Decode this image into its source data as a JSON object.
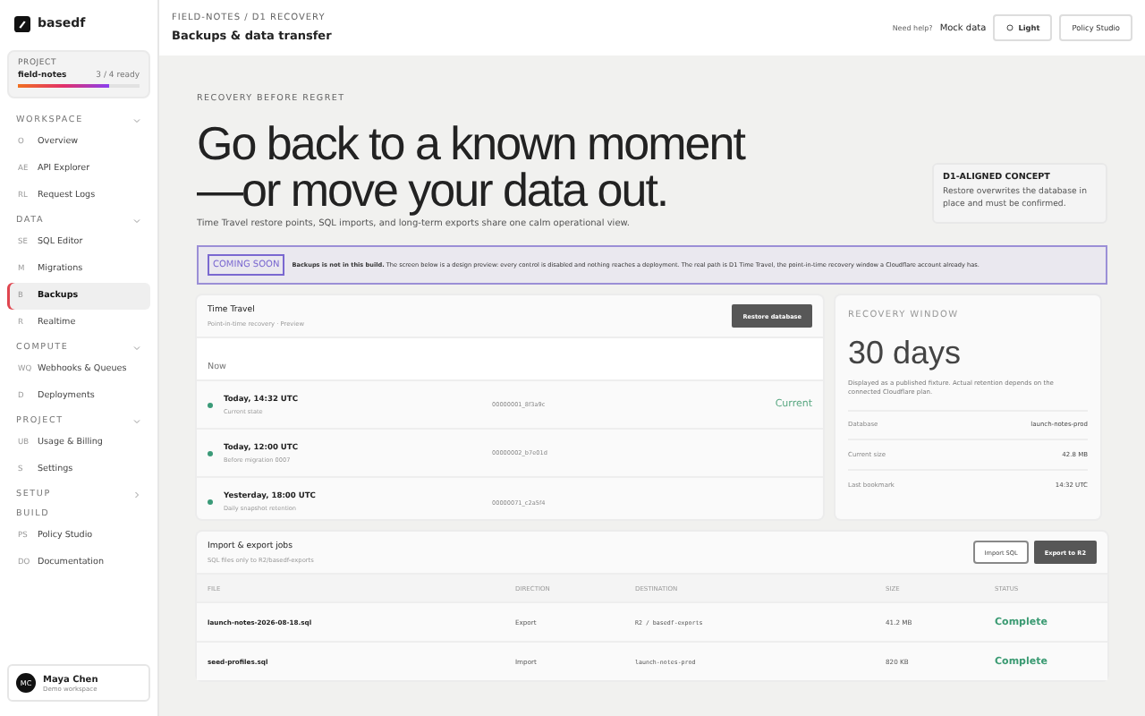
{
  "sidebar": {
    "brand": "basedf",
    "project": {
      "label": "PROJECT",
      "name": "field-notes",
      "status": "3 / 4 ready",
      "level": 0.75
    },
    "sections": [
      {
        "title": "WORKSPACE",
        "expanded": true,
        "items": [
          {
            "code": "O",
            "label": "Overview",
            "selected": false
          },
          {
            "code": "AE",
            "label": "API Explorer",
            "selected": false
          },
          {
            "code": "RL",
            "label": "Request Logs",
            "selected": false
          }
        ]
      },
      {
        "title": "DATA",
        "expanded": true,
        "items": [
          {
            "code": "SE",
            "label": "SQL Editor",
            "selected": false
          },
          {
            "code": "M",
            "label": "Migrations",
            "selected": false
          },
          {
            "code": "B",
            "label": "Backups",
            "selected": true
          },
          {
            "code": "R",
            "label": "Realtime",
            "selected": false
          }
        ]
      },
      {
        "title": "COMPUTE",
        "expanded": true,
        "items": [
          {
            "code": "WQ",
            "label": "Webhooks & Queues",
            "selected": false
          },
          {
            "code": "D",
            "label": "Deployments",
            "selected": false
          }
        ]
      },
      {
        "title": "PROJECT",
        "expanded": true,
        "items": [
          {
            "code": "UB",
            "label": "Usage & Billing",
            "selected": false
          },
          {
            "code": "S",
            "label": "Settings",
            "selected": false
          }
        ]
      },
      {
        "title": "SETUP",
        "expanded": false
      },
      {
        "title": "BUILD",
        "items": [
          {
            "code": "PS",
            "label": "Policy Studio",
            "selected": false
          },
          {
            "code": "DO",
            "label": "Documentation",
            "selected": false
          }
        ]
      }
    ],
    "user": {
      "initials": "MC",
      "name": "Maya Chen",
      "subtitle": "Demo workspace"
    }
  },
  "header": {
    "breadcrumb": "FIELD-NOTES / D1 RECOVERY",
    "title": "Backups & data transfer",
    "help": "Need help?",
    "mock": "Mock data",
    "theme_button": "Light",
    "policy_button": "Policy Studio"
  },
  "hero": {
    "eyebrow": "RECOVERY BEFORE REGRET",
    "headline_1": "Go back to a known moment",
    "headline_2": "—or move your data out.",
    "subtitle": "Time Travel restore points, SQL imports, and long-term exports share one calm operational view.",
    "concept_title": "D1-ALIGNED CONCEPT",
    "concept_text": "Restore overwrites the database in place and must be confirmed."
  },
  "banner": {
    "badge": "COMING SOON",
    "text": "**Backups is not in this build.** The screen below is a design preview: every control is disabled and nothing reaches a deployment. The real path is D1 Time Travel, the point-in-time recovery window a Cloudflare account already has."
  },
  "time_travel": {
    "title": "Time Travel",
    "subtitle": "Point-in-time recovery · Preview",
    "button": "Restore database",
    "filter": "Now",
    "points": [
      {
        "time": "Today, 14:32 UTC",
        "note": "Current state",
        "bookmark": "00000001_8f3a9c",
        "current_label": "Current"
      },
      {
        "time": "Today, 12:00 UTC",
        "note": "Before migration 0007",
        "bookmark": "00000002_b7e01d"
      },
      {
        "time": "Yesterday, 18:00 UTC",
        "note": "Daily snapshot retention",
        "bookmark": "00000071_c2a5f4"
      }
    ]
  },
  "recovery": {
    "label": "RECOVERY WINDOW",
    "value": "30 days",
    "note": "Displayed as a published fixture. Actual retention depends on the connected Cloudflare plan.",
    "rows": [
      {
        "key": "Database",
        "value": "launch-notes-prod"
      },
      {
        "key": "Current size",
        "value": "42.8 MB"
      },
      {
        "key": "Last bookmark",
        "value": "14:32 UTC"
      }
    ]
  },
  "jobs": {
    "title": "Import & export jobs",
    "subtitle": "SQL files only to R2/basedf-exports",
    "import_button": "Import SQL",
    "export_button": "Export to R2",
    "columns": [
      "FILE",
      "DIRECTION",
      "DESTINATION",
      "SIZE",
      "STATUS"
    ],
    "rows": [
      [
        "launch-notes-2026-08-18.sql",
        "Export",
        "R2 / basedf-exports",
        "41.2 MB",
        "Complete"
      ],
      [
        "seed-profiles.sql",
        "Import",
        "launch-notes-prod",
        "820 KB",
        "Complete"
      ]
    ]
  }
}
